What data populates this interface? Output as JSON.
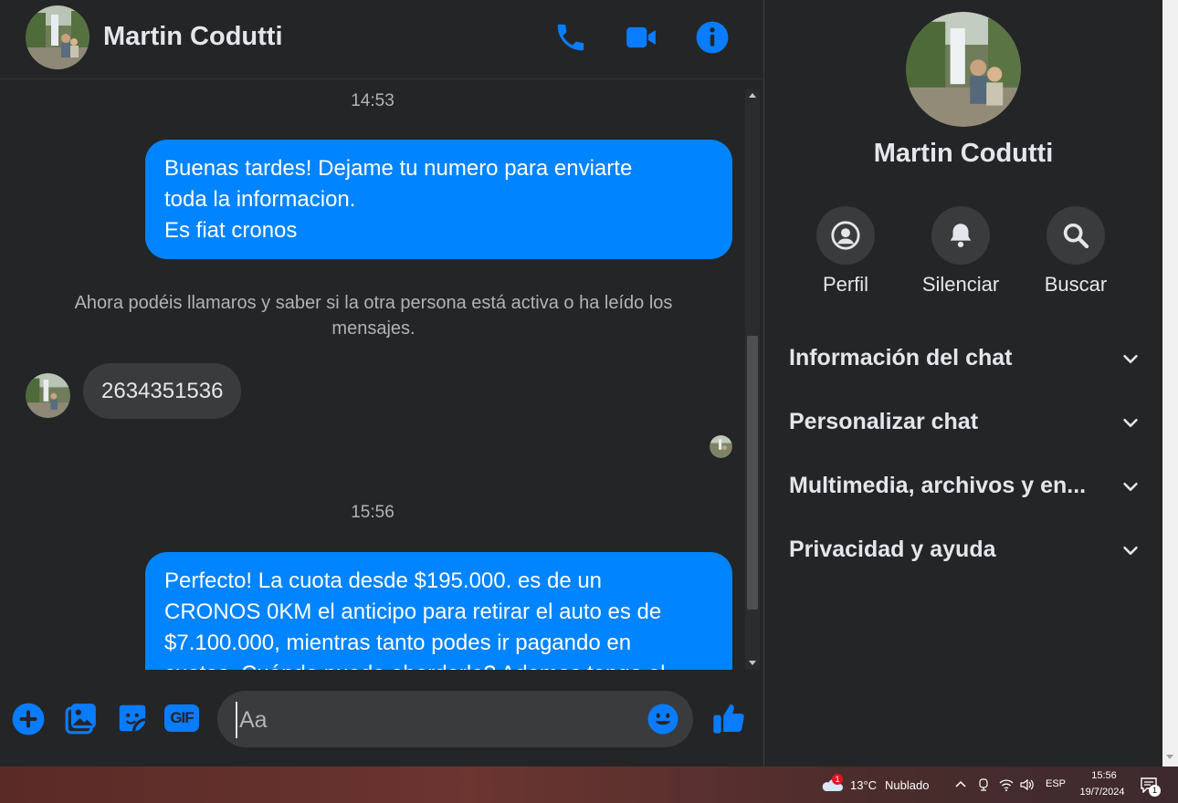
{
  "header": {
    "contact_name": "Martin Codutti",
    "icons": [
      "phone-icon",
      "video-camera-icon",
      "info-icon"
    ]
  },
  "messages": {
    "timestamp_1": "14:53",
    "outgoing_1": [
      "Buenas tardes! Dejame tu numero para enviarte",
      "toda la informacion.",
      "Es fiat cronos"
    ],
    "notice": "Ahora podéis llamaros y saber si la otra persona está activa o ha leído los mensajes.",
    "incoming_1": "2634351536",
    "timestamp_2": "15:56",
    "outgoing_2": [
      "Perfecto! La cuota desde $195.000. es de un",
      "CRONOS 0KM el anticipo para retirar el auto es de",
      "$7.100.000, mientras tanto podes ir pagando en",
      "cuotas. Cuándo pueda abordarla? Ademas tengo el"
    ]
  },
  "composer": {
    "placeholder": "Aa",
    "icons": [
      "add-icon",
      "image-icon",
      "sticker-icon",
      "gif-icon",
      "emoji-icon",
      "thumbs-up-icon"
    ],
    "gif_label": "GIF"
  },
  "profile": {
    "name": "Martin Codutti",
    "actions": [
      {
        "label": "Perfil",
        "icon": "profile-icon"
      },
      {
        "label": "Silenciar",
        "icon": "bell-icon"
      },
      {
        "label": "Buscar",
        "icon": "search-icon"
      }
    ],
    "sections": [
      "Información del chat",
      "Personalizar chat",
      "Multimedia, archivos y en...",
      "Privacidad y ayuda"
    ]
  },
  "taskbar": {
    "weather_temp": "13°C",
    "weather_desc": "Nublado",
    "weather_badge": "1",
    "language": "ESP",
    "time": "15:56",
    "date": "19/7/2024",
    "notification_count": "1"
  },
  "colors": {
    "accent": "#0084ff",
    "background": "#242526",
    "bubble_in": "#3a3b3c",
    "text": "#e4e6eb",
    "muted": "#b0b3b8"
  }
}
